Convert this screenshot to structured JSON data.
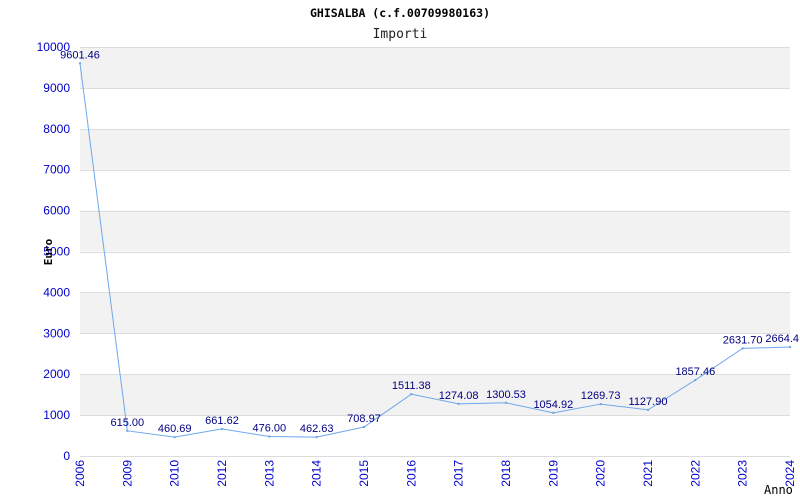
{
  "chart_data": {
    "type": "line",
    "title": "GHISALBA (c.f.00709980163)",
    "subtitle": "Importi",
    "xlabel": "Anno",
    "ylabel": "Euro",
    "categories": [
      "2006",
      "2009",
      "2010",
      "2012",
      "2013",
      "2014",
      "2015",
      "2016",
      "2017",
      "2018",
      "2019",
      "2020",
      "2021",
      "2022",
      "2023",
      "2024"
    ],
    "values": [
      9601.46,
      615.0,
      460.69,
      661.62,
      476.0,
      462.63,
      708.97,
      1511.38,
      1274.08,
      1300.53,
      1054.92,
      1269.73,
      1127.9,
      1857.46,
      2631.7,
      2664.4
    ],
    "data_labels": [
      "9601.46",
      "615.00",
      "460.69",
      "661.62",
      "476.00",
      "462.63",
      "708.97",
      "1511.38",
      "1274.08",
      "1300.53",
      "1054.92",
      "1269.73",
      "1127.90",
      "1857.46",
      "2631.70",
      "2664.4"
    ],
    "y_ticks": [
      0,
      1000,
      2000,
      3000,
      4000,
      5000,
      6000,
      7000,
      8000,
      9000,
      10000
    ],
    "ylim": [
      0,
      10000
    ],
    "grid": true
  },
  "colors": {
    "line": "#6fa8ea",
    "tick_label": "#0000cc",
    "data_label": "#000080",
    "band": "#f2f2f2",
    "gridline": "#dcdcdc"
  }
}
